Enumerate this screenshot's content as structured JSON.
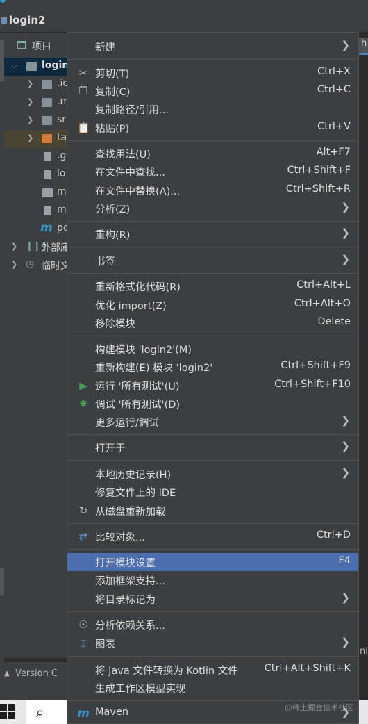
{
  "window": {
    "title": "login2"
  },
  "project_panel": {
    "header": "项目",
    "rows": [
      {
        "label": "login",
        "expanded": true
      },
      {
        "label": ".ic"
      },
      {
        "label": ".m"
      },
      {
        "label": "sr"
      },
      {
        "label": "ta"
      },
      {
        "label": ".g"
      },
      {
        "label": "lo"
      },
      {
        "label": "m"
      },
      {
        "label": "m"
      },
      {
        "label": "pc"
      },
      {
        "label": "外部庫"
      },
      {
        "label": "临时文"
      }
    ]
  },
  "editor": {
    "tab_fragment": "h",
    "gutter_text": "nl"
  },
  "bottom": {
    "version_control": "Version C"
  },
  "menu": {
    "items": [
      {
        "label": "新建",
        "shortcut": "",
        "submenu": true
      },
      {
        "label": "剪切(T)",
        "shortcut": "Ctrl+X",
        "icon": "scissors-icon"
      },
      {
        "label": "复制(C)",
        "shortcut": "Ctrl+C",
        "icon": "copy-icon"
      },
      {
        "label": "复制路径/引用...",
        "shortcut": ""
      },
      {
        "label": "粘贴(P)",
        "shortcut": "Ctrl+V",
        "icon": "paste-icon"
      },
      {
        "label": "查找用法(U)",
        "shortcut": "Alt+F7"
      },
      {
        "label": "在文件中查找...",
        "shortcut": "Ctrl+Shift+F"
      },
      {
        "label": "在文件中替换(A)...",
        "shortcut": "Ctrl+Shift+R"
      },
      {
        "label": "分析(Z)",
        "shortcut": "",
        "submenu": true
      },
      {
        "label": "重构(R)",
        "shortcut": "",
        "submenu": true
      },
      {
        "label": "书签",
        "shortcut": "",
        "submenu": true
      },
      {
        "label": "重新格式化代码(R)",
        "shortcut": "Ctrl+Alt+L"
      },
      {
        "label": "优化 import(Z)",
        "shortcut": "Ctrl+Alt+O"
      },
      {
        "label": "移除模块",
        "shortcut": "Delete"
      },
      {
        "label": "构建模块 'login2'(M)",
        "shortcut": ""
      },
      {
        "label": "重新构建(E) 模块 'login2'",
        "shortcut": "Ctrl+Shift+F9"
      },
      {
        "label": "运行 '所有测试'(U)",
        "shortcut": "Ctrl+Shift+F10",
        "icon": "run-icon"
      },
      {
        "label": "调试 '所有测试'(D)",
        "shortcut": "",
        "icon": "debug-icon"
      },
      {
        "label": "更多运行/调试",
        "shortcut": "",
        "submenu": true
      },
      {
        "label": "打开于",
        "shortcut": "",
        "submenu": true
      },
      {
        "label": "本地历史记录(H)",
        "shortcut": "",
        "submenu": true
      },
      {
        "label": "修复文件上的 IDE",
        "shortcut": ""
      },
      {
        "label": "从磁盘重新加载",
        "shortcut": "",
        "icon": "reload-icon"
      },
      {
        "label": "比较对象...",
        "shortcut": "Ctrl+D",
        "icon": "compare-icon"
      },
      {
        "label": "打开模块设置",
        "shortcut": "F4",
        "active": true
      },
      {
        "label": "添加框架支持...",
        "shortcut": ""
      },
      {
        "label": "将目录标记为",
        "shortcut": "",
        "submenu": true
      },
      {
        "label": "分析依赖关系...",
        "shortcut": "",
        "icon": "dependency-icon"
      },
      {
        "label": "图表",
        "shortcut": "",
        "submenu": true,
        "icon": "diagram-icon"
      },
      {
        "label": "将 Java 文件转换为 Kotlin 文件",
        "shortcut": "Ctrl+Alt+Shift+K"
      },
      {
        "label": "生成工作区模型实现",
        "shortcut": ""
      },
      {
        "label": "Maven",
        "shortcut": "",
        "submenu": true,
        "icon": "maven-icon"
      }
    ]
  },
  "watermark": "@稀土掘金技术社区",
  "colors": {
    "menu_bg": "#3c3f41",
    "selection": "#4b6eaf",
    "run_green": "#499c54"
  }
}
